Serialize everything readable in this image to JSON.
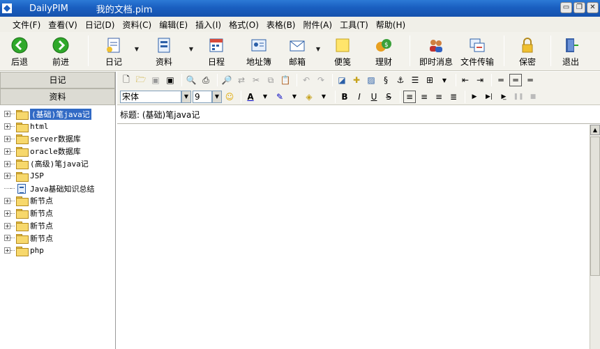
{
  "window": {
    "app_name": "DailyPIM",
    "doc_name": "我的文档.pim",
    "controls": [
      "minimize",
      "restore",
      "close"
    ]
  },
  "menu": [
    "文件(F)",
    "查看(V)",
    "日记(D)",
    "资料(C)",
    "编辑(E)",
    "插入(I)",
    "格式(O)",
    "表格(B)",
    "附件(A)",
    "工具(T)",
    "帮助(H)"
  ],
  "toolbar": {
    "back": "后退",
    "forward": "前进",
    "diary": "日记",
    "data": "资料",
    "schedule": "日程",
    "address": "地址簿",
    "mail": "邮箱",
    "note": "便笺",
    "finance": "理财",
    "im": "即时消息",
    "transfer": "文件传输",
    "secure": "保密",
    "exit": "退出"
  },
  "left_tabs": {
    "diary": "日记",
    "data": "资料"
  },
  "tree": [
    {
      "label": "(基础)笔java记",
      "type": "folder",
      "selected": true
    },
    {
      "label": "html",
      "type": "folder"
    },
    {
      "label": "server数据库",
      "type": "folder"
    },
    {
      "label": "oracle数据库",
      "type": "folder"
    },
    {
      "label": "(高级)笔java记",
      "type": "folder"
    },
    {
      "label": "JSP",
      "type": "folder"
    },
    {
      "label": "Java基础知识总结",
      "type": "doc"
    },
    {
      "label": "新节点",
      "type": "folder"
    },
    {
      "label": "新节点",
      "type": "folder"
    },
    {
      "label": "新节点",
      "type": "folder"
    },
    {
      "label": "新节点",
      "type": "folder"
    },
    {
      "label": "php",
      "type": "folder"
    }
  ],
  "format": {
    "font": "宋体",
    "size": "9"
  },
  "editor": {
    "title_label": "标题:",
    "title_value": "(基础)笔java记"
  },
  "colors": {
    "title_bar": "#1a5fc0",
    "selection": "#316ac5",
    "panel": "#f3f2ec"
  }
}
